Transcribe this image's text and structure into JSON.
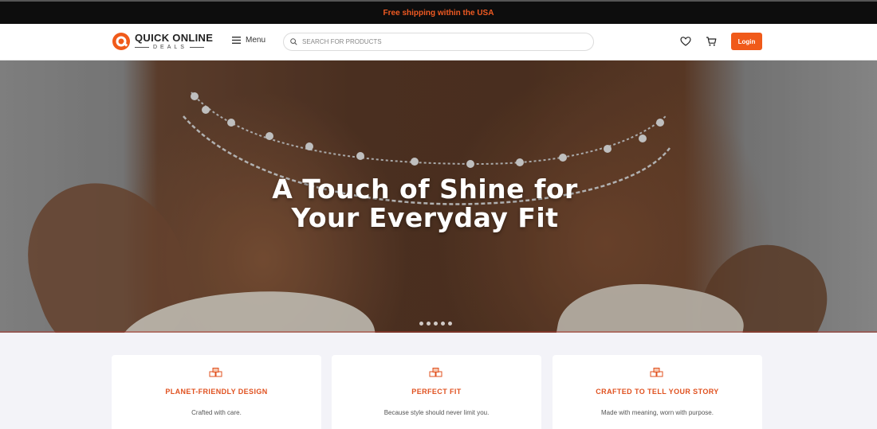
{
  "promo": {
    "text": "Free shipping within the USA"
  },
  "header": {
    "logo_main": "QUICK ONLINE",
    "logo_sub": "DEALS",
    "menu_label": "Menu",
    "search_placeholder": "SEARCH FOR PRODUCTS",
    "login_label": "Login",
    "icons": [
      "heart-icon",
      "cart-icon",
      "search-icon",
      "menu-icon"
    ]
  },
  "hero": {
    "title_line1": "A Touch of Shine for",
    "title_line2": "Your Everyday Fit",
    "slide_count": 5
  },
  "features": [
    {
      "title": "PLANET-FRIENDLY DESIGN",
      "text": "Crafted with care."
    },
    {
      "title": "PERFECT FIT",
      "text": "Because style should never limit you."
    },
    {
      "title": "CRAFTED TO TELL YOUR STORY",
      "text": "Made with meaning, worn with purpose."
    }
  ],
  "colors": {
    "accent": "#f05a1a",
    "promo_bg": "#0d0d0d",
    "feature_title": "#e0511f"
  }
}
